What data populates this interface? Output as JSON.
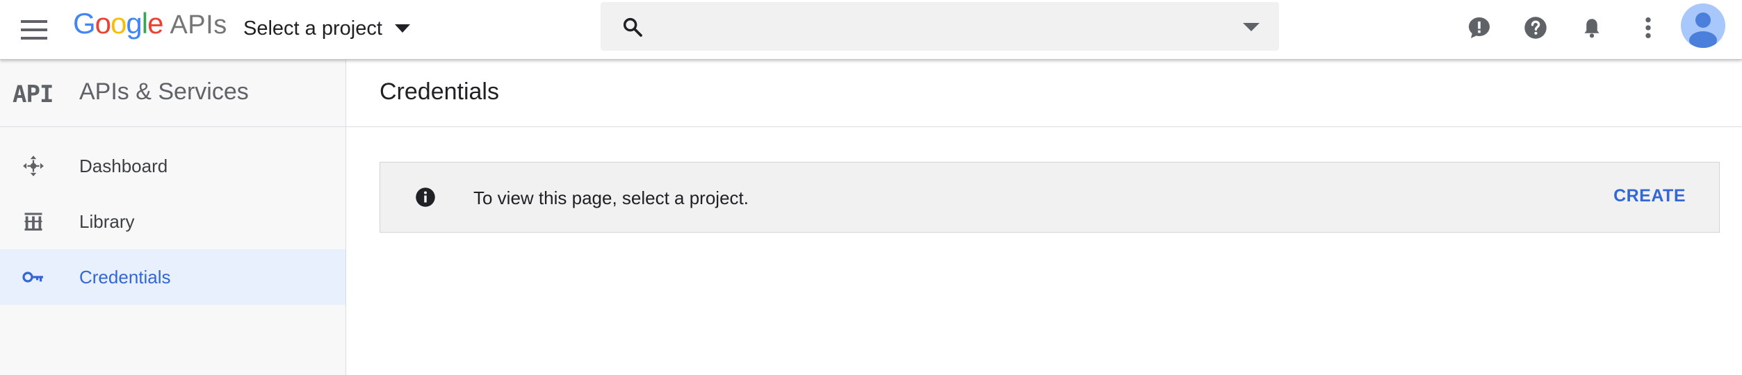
{
  "header": {
    "logo_google": [
      "G",
      "o",
      "o",
      "g",
      "l",
      "e"
    ],
    "logo_google_colors": [
      "#4285f4",
      "#ea4335",
      "#fbbc05",
      "#4285f4",
      "#34a853",
      "#ea4335"
    ],
    "logo_apis": "APIs",
    "project_select_label": "Select a project",
    "search_placeholder": "",
    "icons": [
      "menu-icon",
      "search-icon",
      "feedback-icon",
      "help-icon",
      "notifications-icon",
      "more-vert-icon",
      "account-avatar"
    ]
  },
  "sidebar": {
    "glyph": "API",
    "title": "APIs & Services",
    "items": [
      {
        "label": "Dashboard",
        "icon": "dashboard-icon",
        "active": false
      },
      {
        "label": "Library",
        "icon": "library-icon",
        "active": false
      },
      {
        "label": "Credentials",
        "icon": "key-icon",
        "active": true
      }
    ]
  },
  "main": {
    "title": "Credentials",
    "banner": {
      "message": "To view this page, select a project.",
      "action": "CREATE"
    }
  },
  "colors": {
    "accent": "#3367d6",
    "active_bg": "#e8f0fe",
    "sidebar_bg": "#f8f8f8",
    "banner_bg": "#f1f1f1",
    "icon_gray": "#5f6368",
    "avatar_bg": "#a8c7fa",
    "avatar_fg": "#4a7fdc"
  }
}
